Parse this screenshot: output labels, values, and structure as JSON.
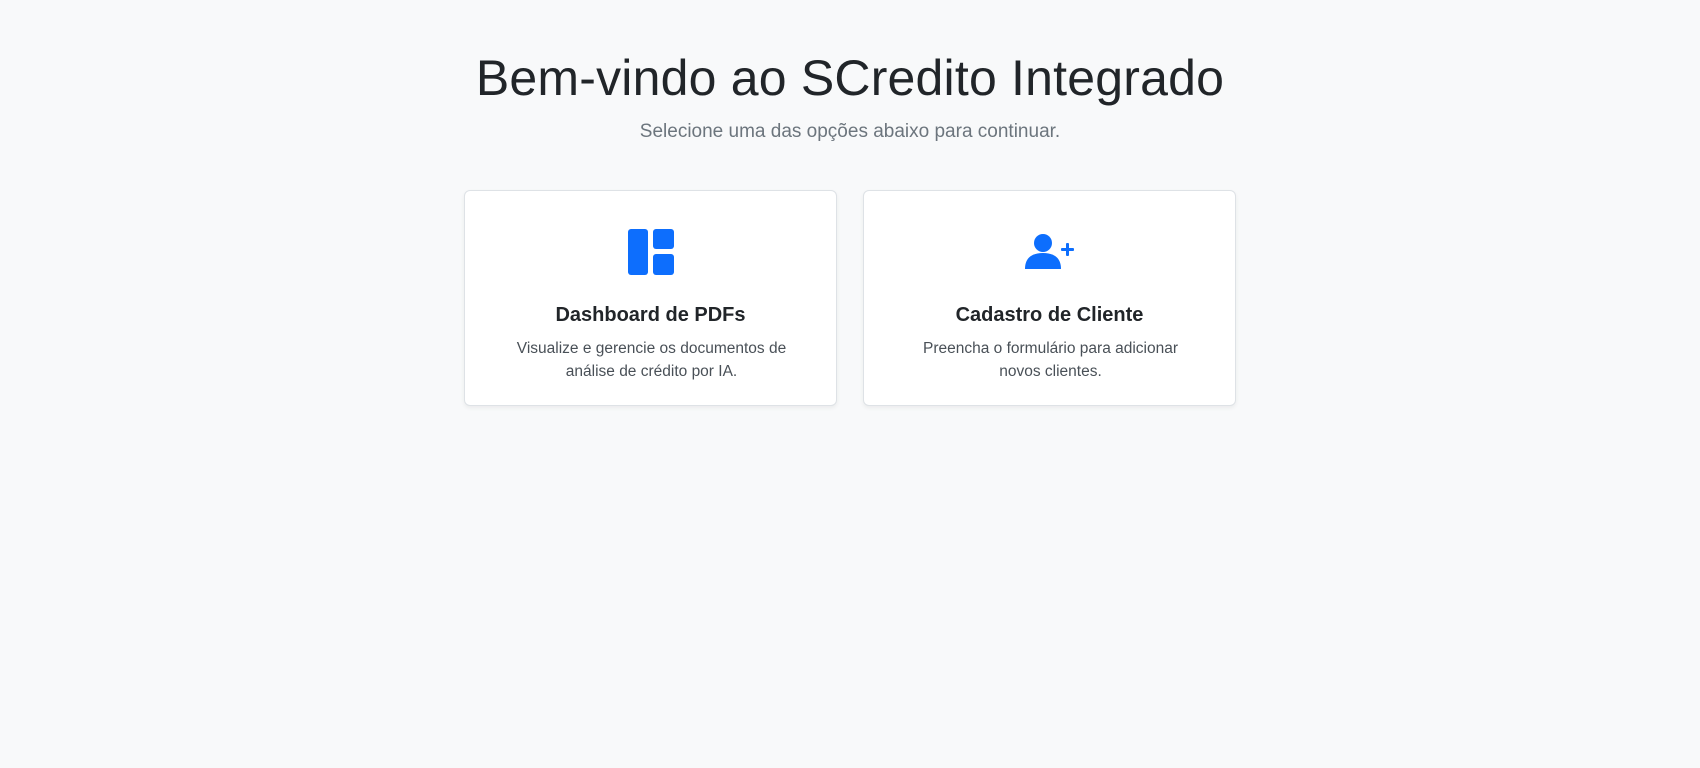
{
  "header": {
    "title": "Bem-vindo ao SCredito Integrado",
    "subtitle": "Selecione uma das opções abaixo para continuar."
  },
  "cards": [
    {
      "icon": "dashboard-layout-icon",
      "title": "Dashboard de PDFs",
      "description": "Visualize e gerencie os documentos de análise de crédito por IA."
    },
    {
      "icon": "user-add-icon",
      "title": "Cadastro de Cliente",
      "description": "Preencha o formulário para adicionar novos clientes."
    }
  ],
  "colors": {
    "accent": "#0d6efd",
    "background": "#f8f9fa",
    "card_border": "#dee2e6"
  }
}
